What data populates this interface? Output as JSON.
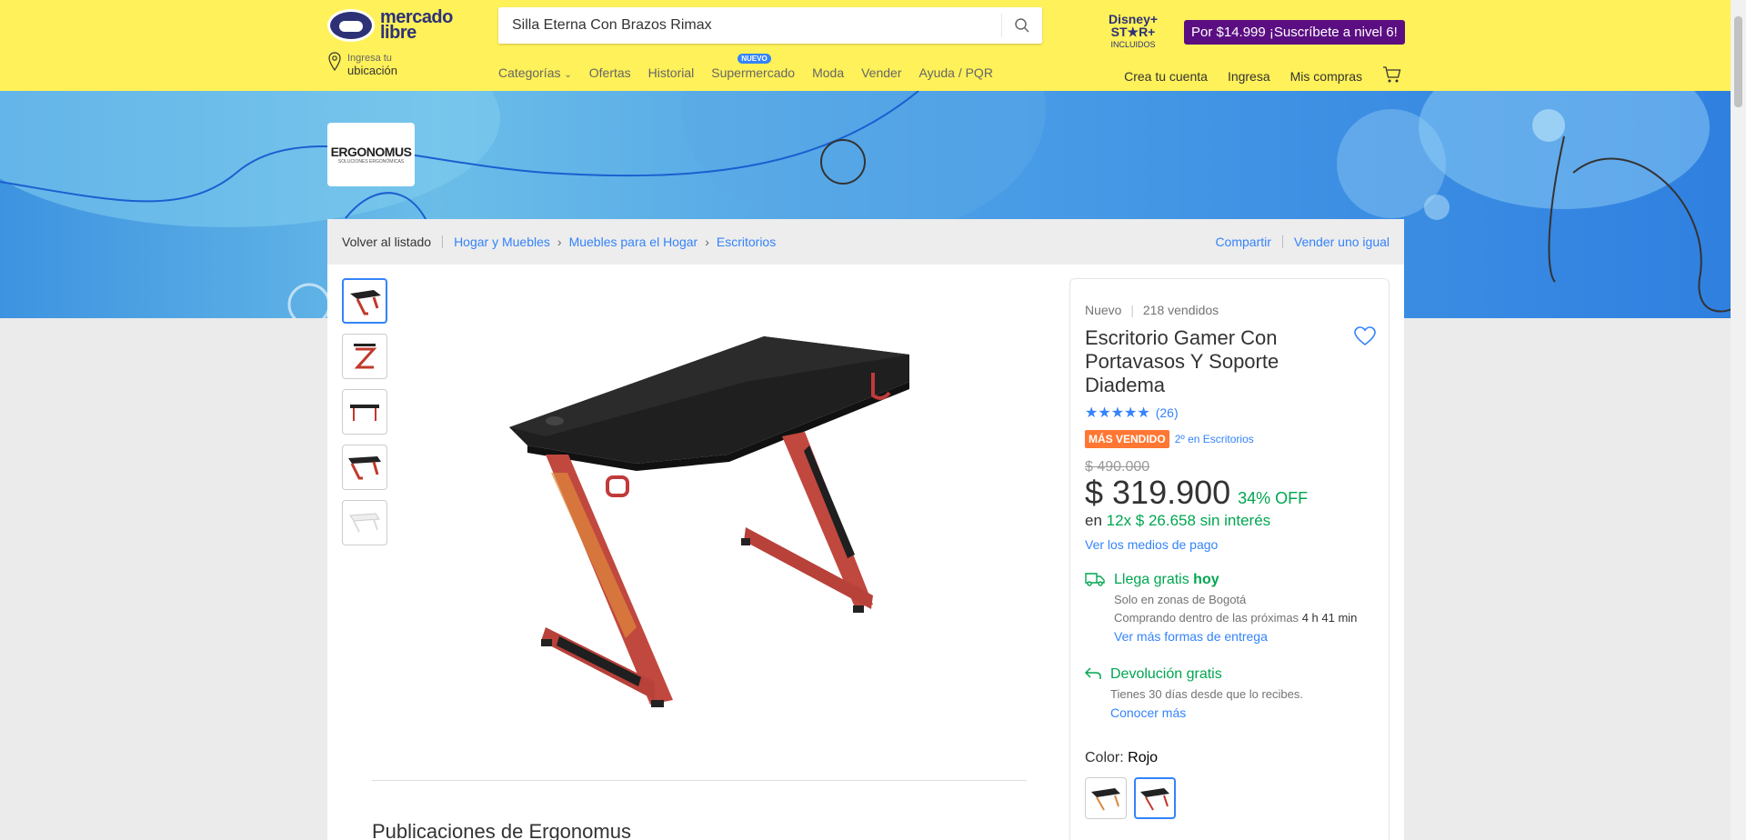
{
  "header": {
    "logo_line1": "mercado",
    "logo_line2": "libre",
    "search_value": "Silla Eterna Con Brazos Rimax",
    "disney_title": "Disney+ ST★R+",
    "disney_sub": "INCLUIDOS",
    "promo_text": "Por $14.999 ¡Suscríbete a nivel 6!",
    "location_small": "Ingresa tu",
    "location_main": "ubicación",
    "nav": [
      "Categorías",
      "Ofertas",
      "Historial",
      "Supermercado",
      "Moda",
      "Vender",
      "Ayuda / PQR"
    ],
    "nav_badge": "NUEVO",
    "account": [
      "Crea tu cuenta",
      "Ingresa",
      "Mis compras"
    ]
  },
  "store": {
    "name": "ERGONOMUS",
    "tagline": "SOLUCIONES ERGONÓMICAS"
  },
  "breadcrumb": {
    "back": "Volver al listado",
    "items": [
      "Hogar y Muebles",
      "Muebles para el Hogar",
      "Escritorios"
    ],
    "share": "Compartir",
    "sell_same": "Vender uno igual"
  },
  "product": {
    "condition": "Nuevo",
    "sold": "218 vendidos",
    "title": "Escritorio Gamer Con Portavasos Y Soporte Diadema",
    "rating_count": "(26)",
    "stars": 5,
    "badge": "MÁS VENDIDO",
    "badge_rank": "2º en Escritorios",
    "old_price": "$ 490.000",
    "price": "$ 319.900",
    "discount": "34% OFF",
    "installment_prefix": "en",
    "installment": "12x $ 26.658 sin interés",
    "payment_link": "Ver los medios de pago",
    "shipping_title": "Llega gratis",
    "shipping_when": "hoy",
    "shipping_zone": "Solo en zonas de Bogotá",
    "shipping_time_prefix": "Comprando dentro de las próximas",
    "shipping_time": "4 h 41 min",
    "shipping_link": "Ver más formas de entrega",
    "return_title": "Devolución gratis",
    "return_desc": "Tienes 30 días desde que lo recibes.",
    "return_link": "Conocer más",
    "color_label": "Color:",
    "color_value": "Rojo",
    "publications_title": "Publicaciones de Ergonomus"
  },
  "colors": {
    "yellow": "#fff159",
    "blue": "#3483fa",
    "green": "#00a650",
    "orange": "#ff7733"
  }
}
